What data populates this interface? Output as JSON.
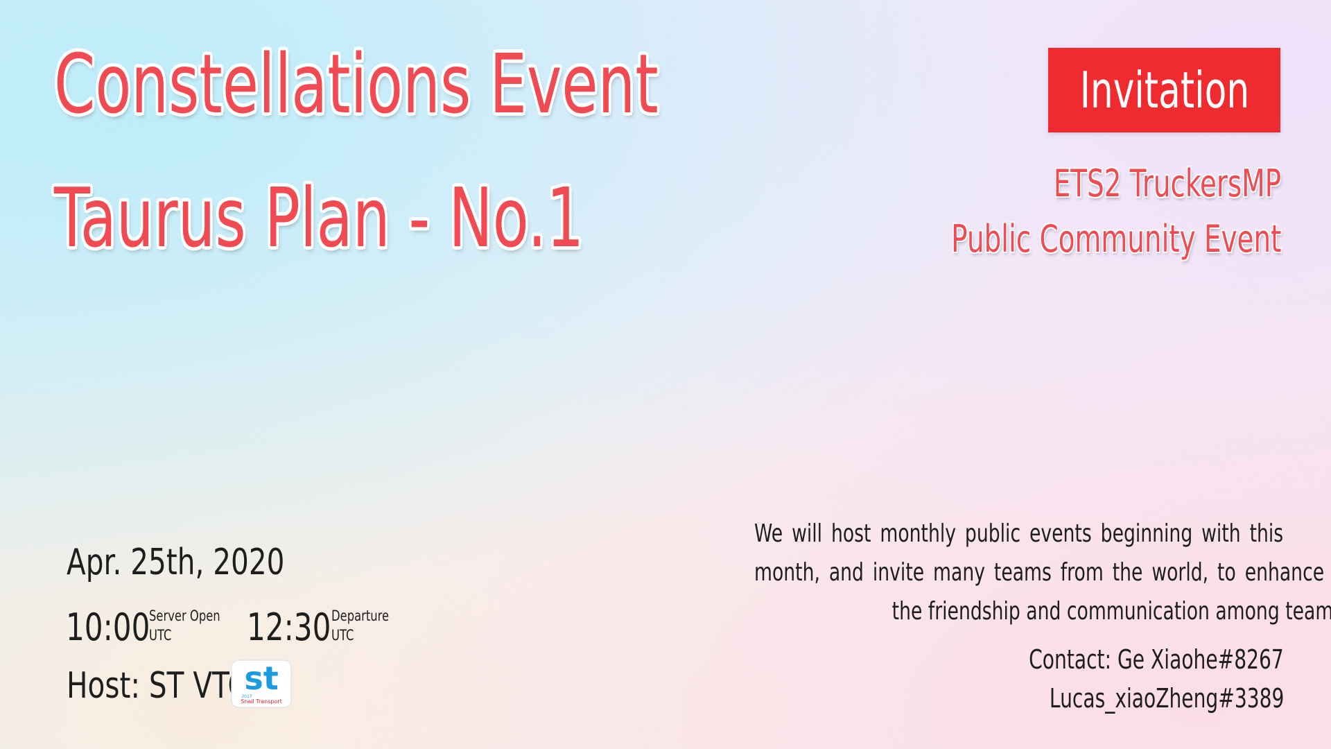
{
  "title": {
    "line1": "Constellations Event",
    "line2": "Taurus Plan - No.1"
  },
  "badge": {
    "label": "Invitation"
  },
  "subtitle": {
    "line1": "ETS2 TruckersMP",
    "line2": "Public Community Event"
  },
  "event": {
    "date": "Apr. 25th, 2020",
    "server_open_time": "10:00",
    "server_open_label": "Server Open",
    "server_open_tz": "UTC",
    "departure_time": "12:30",
    "departure_label": "Departure",
    "departure_tz": "UTC",
    "host": "Host: ST VTC"
  },
  "logo": {
    "letters": "st",
    "year": "2017",
    "caption": "Snail Transport"
  },
  "description": {
    "line1": "We will host monthly public events beginning with this",
    "line2": "month, and invite many teams from the world, to enhance",
    "line3": "the friendship and communication among teams."
  },
  "contact": {
    "line1": "Contact: Ge Xiaohe#8267",
    "line2": "Lucas_xiaoZheng#3389"
  },
  "colors": {
    "accent": "#ef2b2f",
    "title_text": "#f04a52",
    "body_text": "#1e1e1e",
    "logo_blue": "#1d9be0"
  }
}
